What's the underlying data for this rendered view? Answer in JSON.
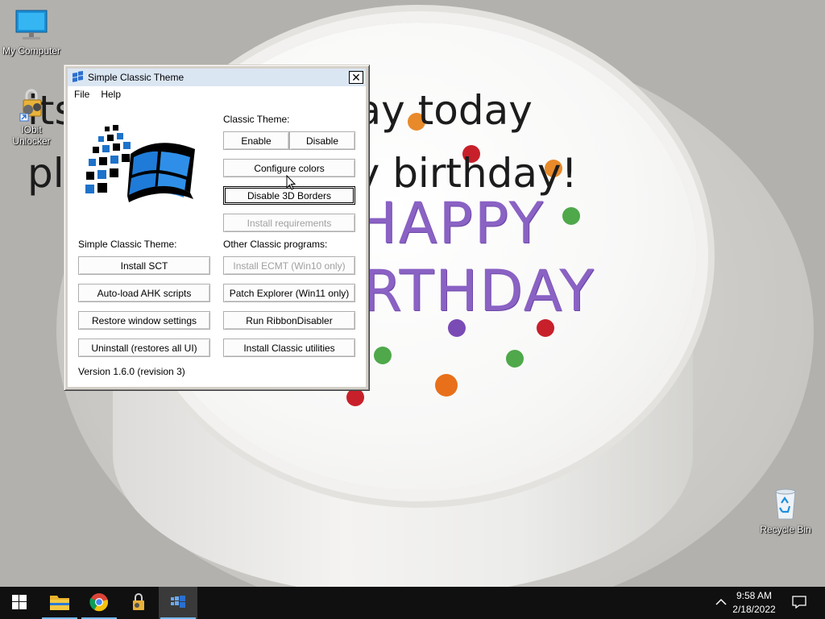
{
  "desktop": {
    "wallpaper_lines": [
      "its my18s birthday today",
      "please say happy birthday!"
    ],
    "cake_text": [
      "HAPPY",
      "RTHDAY"
    ],
    "icons": [
      {
        "label": "My Computer",
        "icon": "monitor-icon"
      },
      {
        "label": "IObit Unlocker",
        "icon": "lock-gears-icon"
      },
      {
        "label": "Recycle Bin",
        "icon": "recycle-bin-icon"
      }
    ]
  },
  "window": {
    "title": "Simple Classic Theme",
    "menu": [
      "File",
      "Help"
    ],
    "classic_theme_label": "Classic Theme:",
    "enable_label": "Enable",
    "disable_label": "Disable",
    "configure_colors_label": "Configure colors",
    "disable_3d_borders_label": "Disable 3D Borders",
    "install_requirements_label": "Install requirements",
    "sct_label": "Simple Classic Theme:",
    "other_programs_label": "Other Classic programs:",
    "install_sct_label": "Install SCT",
    "install_ecmt_label": "Install ECMT (Win10 only)",
    "autoload_ahk_label": "Auto-load AHK scripts",
    "patch_explorer_label": "Patch Explorer (Win11 only)",
    "restore_window_label": "Restore window settings",
    "run_ribbon_label": "Run RibbonDisabler",
    "uninstall_label": "Uninstall (restores all UI)",
    "install_utilities_label": "Install Classic utilities",
    "version": "Version 1.6.0 (revision 3)"
  },
  "taskbar": {
    "items": [
      "start-icon",
      "file-explorer-icon",
      "chrome-icon",
      "iobit-unlocker-icon",
      "simple-classic-theme-icon"
    ],
    "active_item": "simple-classic-theme-icon",
    "time": "9:58 AM",
    "date": "2/18/2022"
  },
  "colors": {
    "taskbar": "#101010",
    "window_face": "#d4d0c8",
    "titlebar": "#dbe6f3",
    "cake_text": "#8a62c4"
  }
}
